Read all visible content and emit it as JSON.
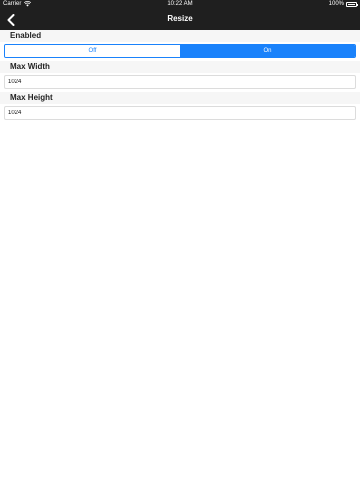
{
  "status_bar": {
    "carrier": "Carrier",
    "time": "10:22 AM",
    "battery": "100%",
    "wifi_icon": "wifi-icon",
    "battery_icon": "battery-icon"
  },
  "nav": {
    "title": "Resize",
    "back_icon": "chevron-left-icon"
  },
  "sections": {
    "enabled": {
      "header": "Enabled",
      "options": [
        "Off",
        "On"
      ],
      "selected": "On"
    },
    "max_width": {
      "header": "Max Width",
      "value": "1024"
    },
    "max_height": {
      "header": "Max Height",
      "value": "1024"
    }
  },
  "colors": {
    "nav_background": "#1f1f1f",
    "accent": "#1a82fb",
    "section_background": "#f6f6f6"
  }
}
